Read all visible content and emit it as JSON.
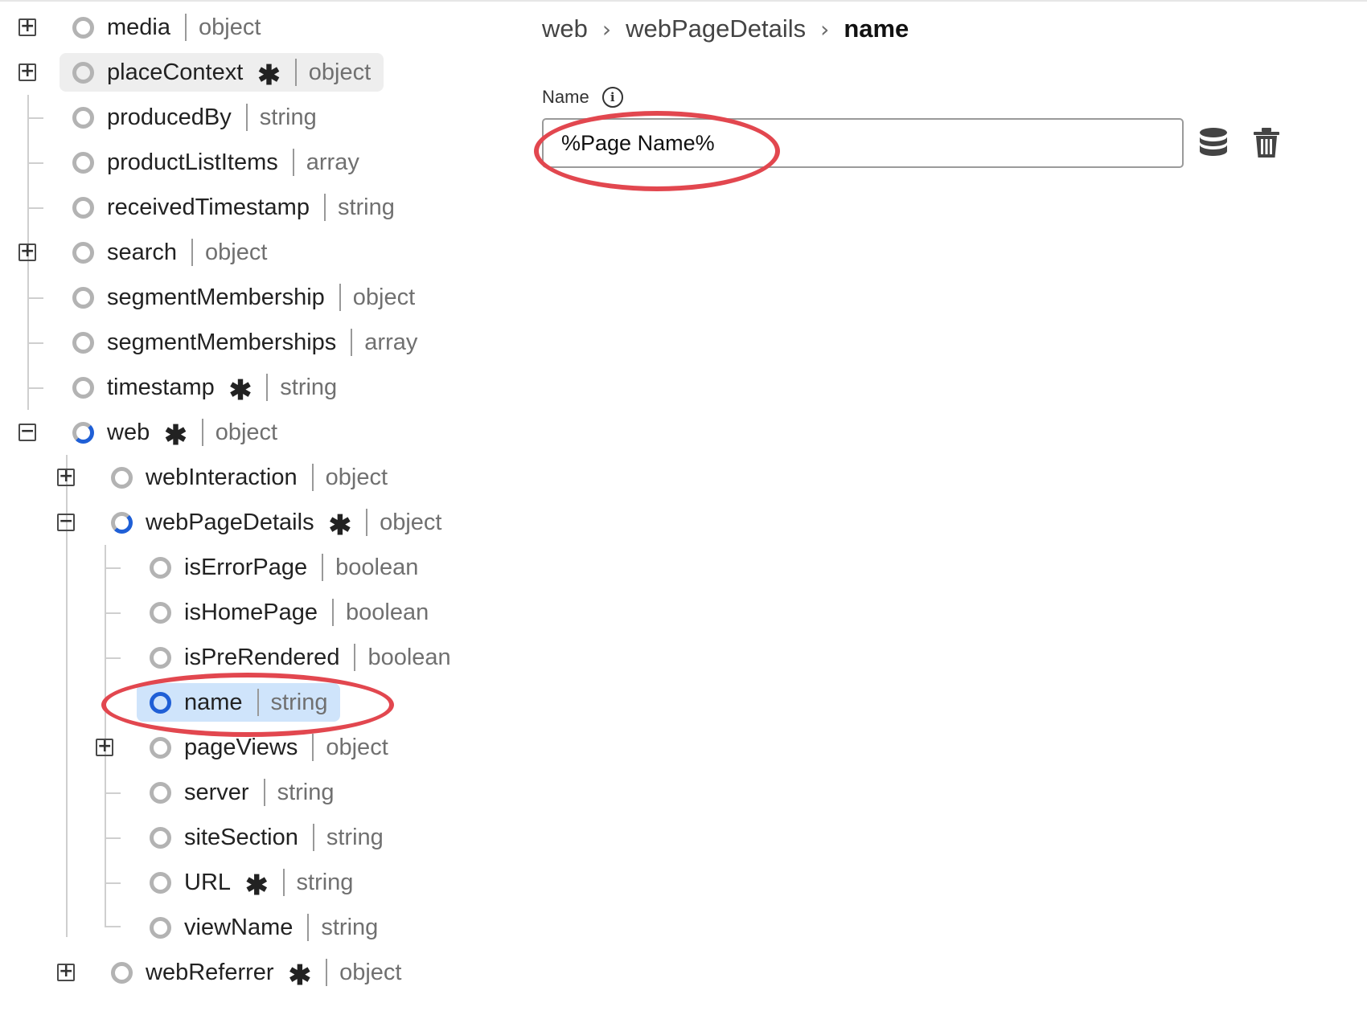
{
  "tree": {
    "rows": [
      {
        "id": "media",
        "name": "media",
        "type": "object",
        "required": false,
        "expand": "+"
      },
      {
        "id": "placeContext",
        "name": "placeContext",
        "type": "object",
        "required": true,
        "expand": "+"
      },
      {
        "id": "producedBy",
        "name": "producedBy",
        "type": "string",
        "required": false,
        "expand": ""
      },
      {
        "id": "productListItems",
        "name": "productListItems",
        "type": "array",
        "required": false,
        "expand": ""
      },
      {
        "id": "receivedTimestamp",
        "name": "receivedTimestamp",
        "type": "string",
        "required": false,
        "expand": ""
      },
      {
        "id": "search",
        "name": "search",
        "type": "object",
        "required": false,
        "expand": "+"
      },
      {
        "id": "segmentMembership",
        "name": "segmentMembership",
        "type": "object",
        "required": false,
        "expand": ""
      },
      {
        "id": "segmentMemberships",
        "name": "segmentMemberships",
        "type": "array",
        "required": false,
        "expand": ""
      },
      {
        "id": "timestamp",
        "name": "timestamp",
        "type": "string",
        "required": true,
        "expand": ""
      },
      {
        "id": "web",
        "name": "web",
        "type": "object",
        "required": true,
        "expand": "−"
      },
      {
        "id": "webInteraction",
        "name": "webInteraction",
        "type": "object",
        "required": false,
        "expand": "+"
      },
      {
        "id": "webPageDetails",
        "name": "webPageDetails",
        "type": "object",
        "required": true,
        "expand": "−"
      },
      {
        "id": "isErrorPage",
        "name": "isErrorPage",
        "type": "boolean",
        "required": false,
        "expand": ""
      },
      {
        "id": "isHomePage",
        "name": "isHomePage",
        "type": "boolean",
        "required": false,
        "expand": ""
      },
      {
        "id": "isPreRendered",
        "name": "isPreRendered",
        "type": "boolean",
        "required": false,
        "expand": ""
      },
      {
        "id": "name",
        "name": "name",
        "type": "string",
        "required": false,
        "expand": ""
      },
      {
        "id": "pageViews",
        "name": "pageViews",
        "type": "object",
        "required": false,
        "expand": "+"
      },
      {
        "id": "server",
        "name": "server",
        "type": "string",
        "required": false,
        "expand": ""
      },
      {
        "id": "siteSection",
        "name": "siteSection",
        "type": "string",
        "required": false,
        "expand": ""
      },
      {
        "id": "URL",
        "name": "URL",
        "type": "string",
        "required": true,
        "expand": ""
      },
      {
        "id": "viewName",
        "name": "viewName",
        "type": "string",
        "required": false,
        "expand": ""
      },
      {
        "id": "webReferrer",
        "name": "webReferrer",
        "type": "object",
        "required": true,
        "expand": "+"
      }
    ],
    "required_marker": "✱"
  },
  "breadcrumb": {
    "items": [
      "web",
      "webPageDetails",
      "name"
    ],
    "separator": "›"
  },
  "field": {
    "label": "Name",
    "info_glyph": "i",
    "value": "%Page Name%"
  },
  "icons": {
    "info": "info-icon",
    "database": "database-icon",
    "delete": "trash-icon"
  },
  "colors": {
    "selected_blue": "#1f5fd6",
    "selected_bg": "#cfe4fb",
    "annotation_red": "#e2474f"
  }
}
